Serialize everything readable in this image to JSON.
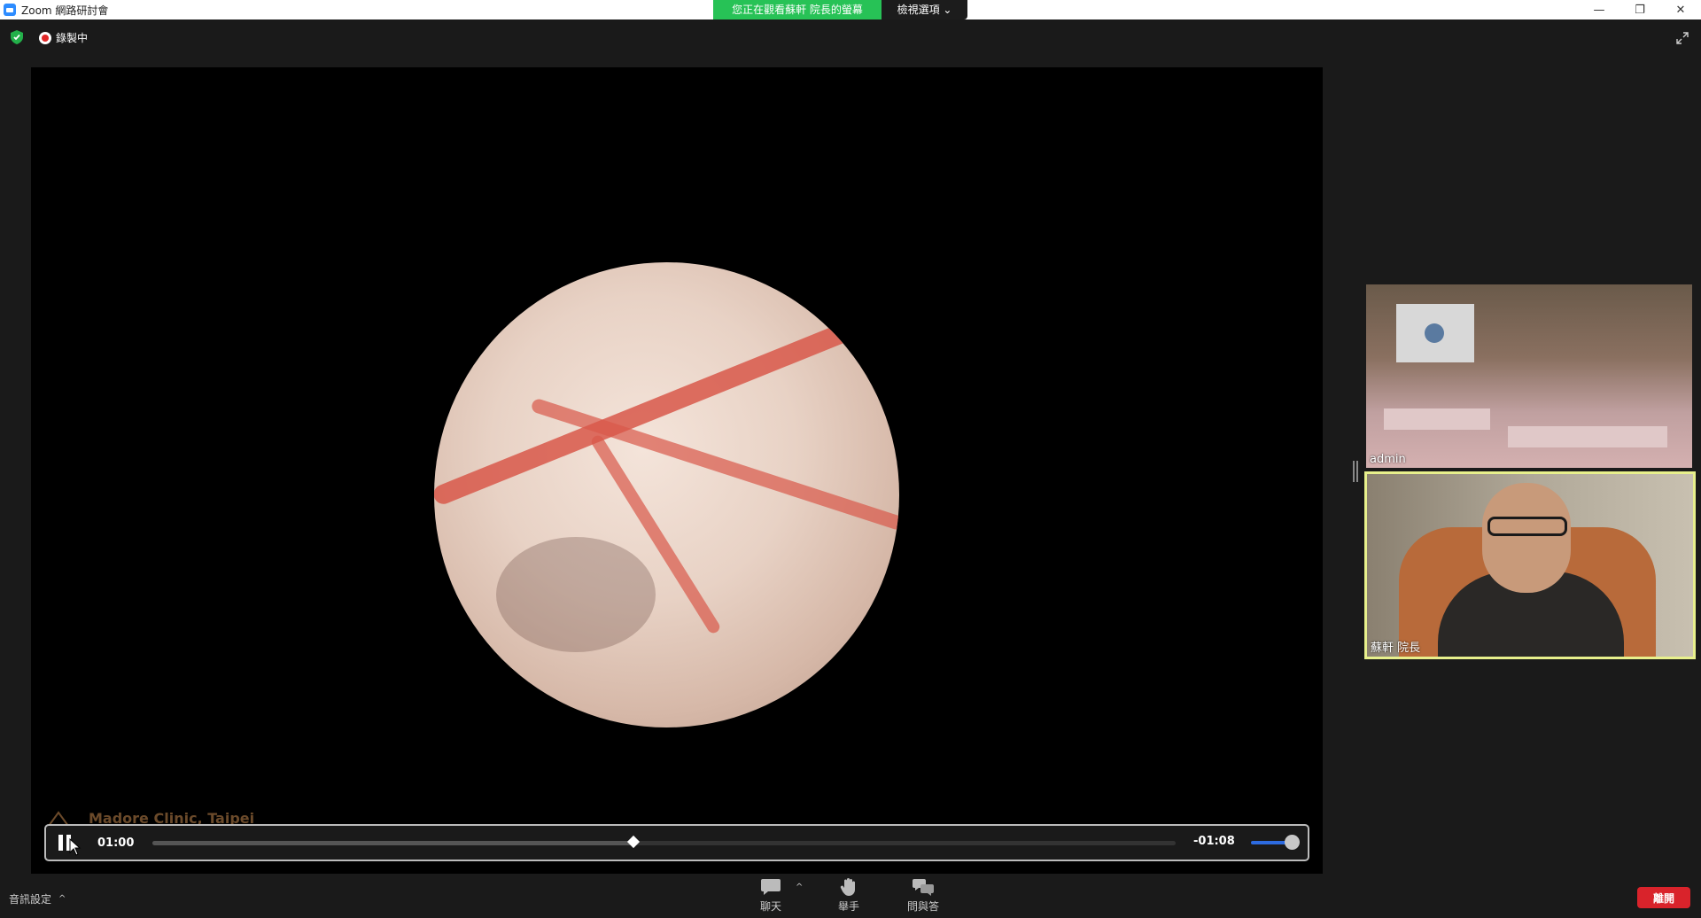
{
  "window": {
    "title": "Zoom 網路研討會",
    "minimize": "—",
    "restore": "❐",
    "close": "✕"
  },
  "share_banner": {
    "status": "您正在觀看蘇軒 院長的螢幕",
    "view_options": "檢視選項 ⌄"
  },
  "status": {
    "recording": "錄製中"
  },
  "player": {
    "elapsed": "01:00",
    "remaining": "-01:08",
    "progress": 0.47,
    "volume": 1.0
  },
  "shared_content": {
    "watermark": "Madore Clinic, Taipei"
  },
  "participants": [
    {
      "name": "admin"
    },
    {
      "name": "蘇軒 院長",
      "active_speaker": true
    }
  ],
  "toolbar": {
    "audio_settings": "音訊設定",
    "chat": "聊天",
    "raise_hand": "舉手",
    "qa": "問與答",
    "leave": "離開"
  },
  "colors": {
    "share_green": "#27c256",
    "leave_red": "#d9232b",
    "speaker_highlight": "#e8f08c",
    "volume_blue": "#2d6be0"
  }
}
